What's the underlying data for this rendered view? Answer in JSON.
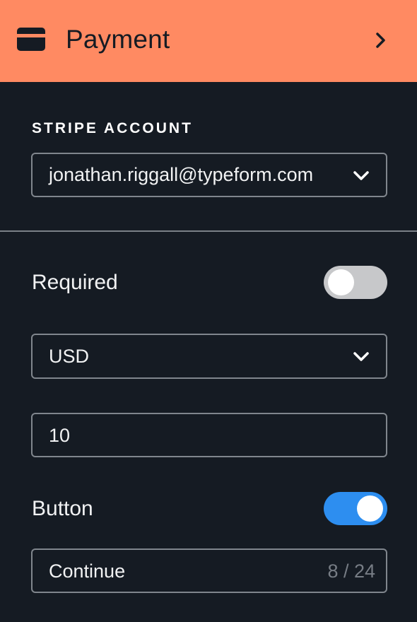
{
  "header": {
    "title": "Payment",
    "icon": "credit-card-icon",
    "nav_icon": "chevron-right-icon",
    "background_color": "#ff8a62"
  },
  "stripe": {
    "section_label": "STRIPE ACCOUNT",
    "account": "jonathan.riggall@typeform.com"
  },
  "required": {
    "label": "Required",
    "enabled": false
  },
  "currency": {
    "selected": "USD"
  },
  "price": {
    "value": "10"
  },
  "button": {
    "label": "Button",
    "enabled": true,
    "toggle_color": "#2d8ef0",
    "text": "Continue",
    "counter": "8 / 24"
  }
}
